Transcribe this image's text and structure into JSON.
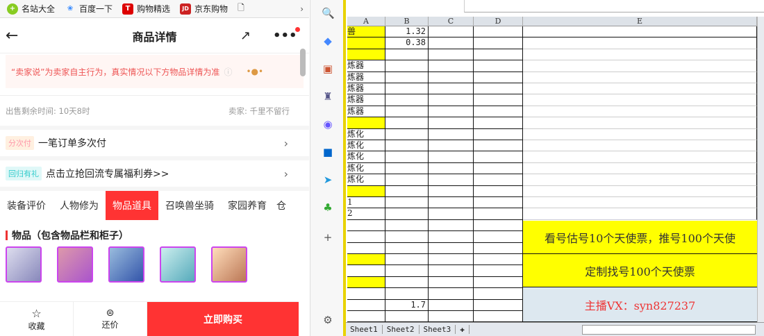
{
  "bookmarks": [
    {
      "label": "名站大全",
      "color": "#8c2"
    },
    {
      "label": "百度一下",
      "color": "#38f"
    },
    {
      "label": "购物精选",
      "color": "#d00",
      "glyph": "T"
    },
    {
      "label": "京东购物",
      "color": "#c22",
      "glyph": "JD"
    }
  ],
  "page": {
    "title": "商品详情",
    "notice": "“卖家说”为卖家自主行为，真实情况以下方物品详情为准",
    "remaining": "出售剩余时间: 10天8时",
    "seller": "卖家: 千里不留行",
    "installment_tag": "分次付",
    "installment_text": "一笔订单多次付",
    "return_tag": "回归有礼",
    "return_text": "点击立抢回流专属福利券>>",
    "tabs": [
      "装备评价",
      "人物修为",
      "物品道具",
      "召唤兽坐骑",
      "家园养育",
      "仓"
    ],
    "active_tab": 2,
    "section_title": "物品（包含物品栏和柜子）",
    "bottom": {
      "favorite": "收藏",
      "bargain": "还价",
      "buy": "立即购买"
    }
  },
  "sheet": {
    "columns": [
      "A",
      "B",
      "C",
      "D",
      "E"
    ],
    "rows": [
      [
        "兽",
        "1.32"
      ],
      [
        "",
        "0.38"
      ],
      [
        "",
        ""
      ],
      [
        "炼器",
        ""
      ],
      [
        "炼器",
        ""
      ],
      [
        "炼器",
        ""
      ],
      [
        "炼器",
        ""
      ],
      [
        "炼器",
        ""
      ],
      [
        "",
        ""
      ],
      [
        "炼化",
        ""
      ],
      [
        "炼化",
        ""
      ],
      [
        "炼化",
        ""
      ],
      [
        "炼化",
        ""
      ],
      [
        "炼化",
        ""
      ],
      [
        "",
        ""
      ],
      [
        "1",
        ""
      ],
      [
        "2",
        ""
      ],
      [
        "",
        ""
      ],
      [
        "",
        ""
      ],
      [
        "",
        ""
      ],
      [
        "",
        ""
      ],
      [
        "",
        ""
      ],
      [
        "",
        ""
      ],
      [
        "",
        ""
      ],
      [
        "",
        "1.7"
      ],
      [
        "",
        ""
      ]
    ],
    "yellow_rows": [
      0,
      1,
      2,
      8,
      14,
      20,
      22
    ],
    "e_blocks": [
      {
        "text": "看号估号10个天使票，推号100个天使",
        "bg": "#ffff00",
        "color": "#333"
      },
      {
        "text": "定制找号100个天使票",
        "bg": "#ffff00",
        "color": "#333"
      },
      {
        "text": "主播VX：syn827237",
        "bg": "#dde8f0",
        "color": "#e33"
      }
    ],
    "sheet_tabs": [
      "Sheet1",
      "Sheet2",
      "Sheet3"
    ]
  }
}
